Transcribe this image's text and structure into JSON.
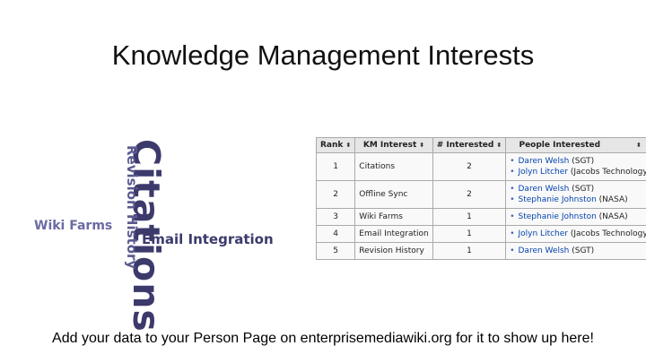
{
  "slide": {
    "title": "Knowledge Management Interests",
    "footer": "Add your data to your Person Page on enterprisemediawiki.org for it to show up here!"
  },
  "word_cloud": {
    "words": [
      "Citations",
      "Revision History",
      "Wiki Farms",
      "Email Integration"
    ]
  },
  "table": {
    "headers": [
      "Rank",
      "KM Interest",
      "# Interested",
      "People Interested"
    ],
    "sort_icon": "⬍",
    "rows": [
      {
        "rank": "1",
        "interest": "Citations",
        "count": "2",
        "people": [
          {
            "name": "Daren Welsh",
            "org": " (SGT)"
          },
          {
            "name": "Jolyn Litcher",
            "org": " (Jacobs Technology)"
          }
        ]
      },
      {
        "rank": "2",
        "interest": "Offline Sync",
        "count": "2",
        "people": [
          {
            "name": "Daren Welsh",
            "org": " (SGT)"
          },
          {
            "name": "Stephanie Johnston",
            "org": " (NASA)"
          }
        ]
      },
      {
        "rank": "3",
        "interest": "Wiki Farms",
        "count": "1",
        "people": [
          {
            "name": "Stephanie Johnston",
            "org": " (NASA)"
          }
        ]
      },
      {
        "rank": "4",
        "interest": "Email Integration",
        "count": "1",
        "people": [
          {
            "name": "Jolyn Litcher",
            "org": " (Jacobs Technology)"
          }
        ]
      },
      {
        "rank": "5",
        "interest": "Revision History",
        "count": "1",
        "people": [
          {
            "name": "Daren Welsh",
            "org": " (SGT)"
          }
        ]
      }
    ]
  },
  "colors": {
    "cloud_dark": "#3c3a6b",
    "cloud_light": "#6b6aa3",
    "link": "#0645ad"
  }
}
